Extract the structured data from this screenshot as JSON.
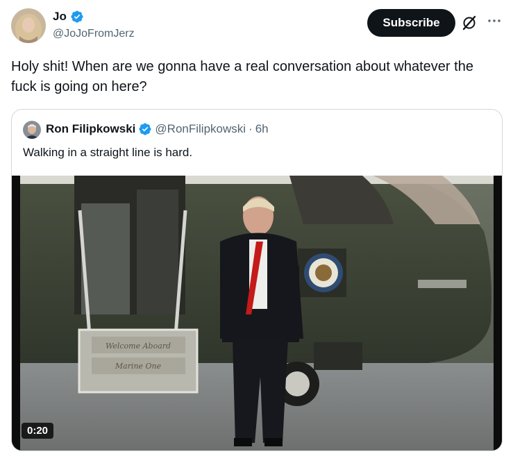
{
  "tweet": {
    "author_name": "Jo",
    "author_handle": "@JoJoFromJerz",
    "subscribe_label": "Subscribe",
    "text": "Holy shit! When are we gonna have a real conversation about whatever the fuck is going on here?"
  },
  "quote": {
    "author_name": "Ron Filipkowski",
    "author_handle": "@RonFilipkowski",
    "separator": "·",
    "time": "6h",
    "text": "Walking in a straight line is hard.",
    "media": {
      "type": "video",
      "duration": "0:20",
      "stair_sign_line1": "Welcome Aboard",
      "stair_sign_line2": "Marine One"
    }
  },
  "icons": {
    "verified": "verified-badge-icon",
    "grok": "grok-icon",
    "more": "more-icon"
  },
  "colors": {
    "verified_blue": "#1d9bf0",
    "text": "#0f1419",
    "secondary_text": "#536471",
    "border": "#cfd9de",
    "button_bg": "#0f1419"
  }
}
